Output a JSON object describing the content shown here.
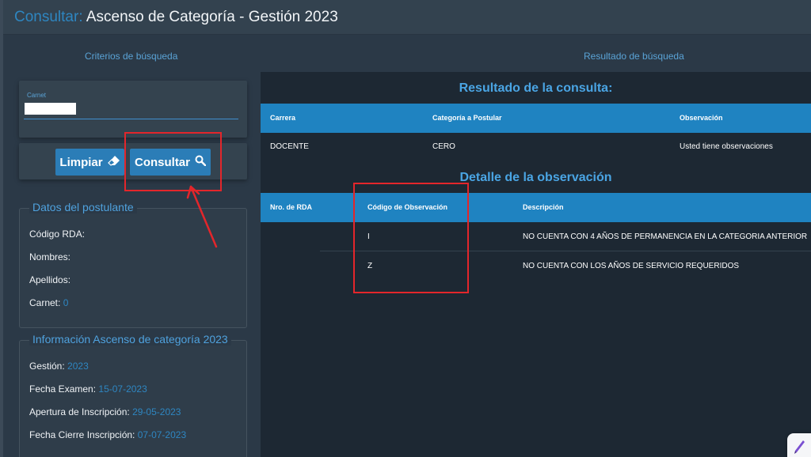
{
  "header": {
    "prefix": "Consultar:",
    "title": "Ascenso de Categoría - Gestión 2023"
  },
  "left": {
    "section_label": "Criterios de búsqueda",
    "carnet_label": "Carnet",
    "carnet_value": "",
    "buttons": {
      "limpiar": "Limpiar",
      "consultar": "Consultar"
    },
    "datos": {
      "legend": "Datos del postulante",
      "codigo_rda": "Código RDA:",
      "nombres": "Nombres:",
      "apellidos": "Apellidos:",
      "carnet": "Carnet:",
      "carnet_value": "0"
    },
    "info": {
      "legend": "Información Ascenso de categoría 2023",
      "gestion_label": "Gestión:",
      "gestion_value": "2023",
      "fecha_examen_label": "Fecha Examen:",
      "fecha_examen_value": "15-07-2023",
      "apertura_label": "Apertura de Inscripción:",
      "apertura_value": "29-05-2023",
      "cierre_label": "Fecha Cierre Inscripción:",
      "cierre_value": "07-07-2023"
    }
  },
  "right": {
    "section_label": "Resultado de búsqueda",
    "result_title": "Resultado de la consulta:",
    "result_columns": [
      "Carrera",
      "Categoría a Postular",
      "Observación"
    ],
    "result_rows": [
      [
        "DOCENTE",
        "CERO",
        "Usted tiene observaciones"
      ]
    ],
    "detail_title": "Detalle de la observación",
    "detail_columns": [
      "Nro. de RDA",
      "Código de Observación",
      "Descripción"
    ],
    "detail_rows": [
      [
        "",
        "I",
        "NO CUENTA CON 4 AÑOS DE PERMANENCIA EN LA CATEGORIA ANTERIOR"
      ],
      [
        "",
        "Z",
        "NO CUENTA CON LOS AÑOS DE SERVICIO REQUERIDOS"
      ]
    ]
  },
  "colors": {
    "background": "#2b3947",
    "accent": "#2e86c1",
    "table_header": "#1f83c1",
    "result_panel": "#1d2833",
    "annotation": "#e3262b"
  },
  "icons": {
    "limpiar": "eraser-icon",
    "consultar": "search-icon",
    "corner_widget": "pen-icon"
  }
}
